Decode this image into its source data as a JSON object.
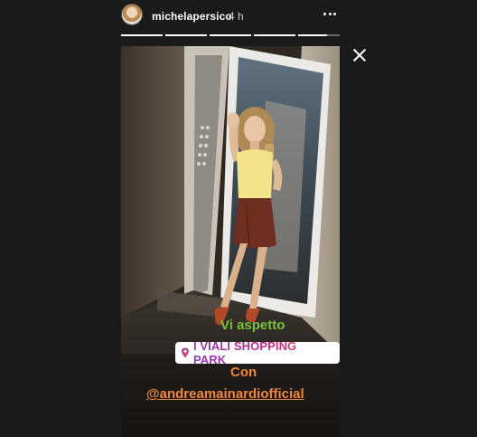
{
  "header": {
    "username": "michelapersico",
    "time": "4 h"
  },
  "progress": [
    1,
    1,
    1,
    1,
    0.7
  ],
  "story": {
    "line1": "Vi aspetto",
    "location": "I VIALI SHOPPING PARK",
    "line3": "Con",
    "mention": "@andreamainardiofficial"
  },
  "colors": {
    "green_text": "#7bc33f",
    "orange_text": "#f0873a",
    "location_gradient": [
      "#8a3ab9",
      "#bc2a8d",
      "#e95950"
    ]
  },
  "icons": {
    "more": "more-horizontal-icon",
    "close": "close-icon",
    "location": "location-pin-icon"
  }
}
